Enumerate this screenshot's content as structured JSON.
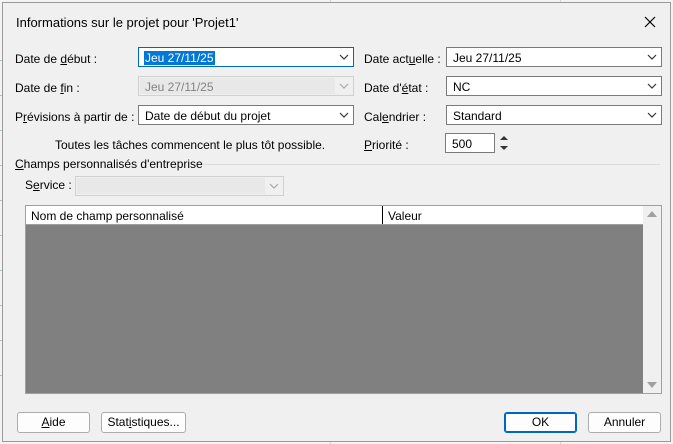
{
  "dialog": {
    "title": "Informations sur le projet pour 'Projet1'"
  },
  "fields": {
    "start_date": {
      "label_pre": "Date de ",
      "label_ul": "d",
      "label_post": "ébut :",
      "value": "Jeu 27/11/25"
    },
    "end_date": {
      "label_pre": "Date de ",
      "label_ul": "f",
      "label_post": "in :",
      "value": "Jeu 27/11/25"
    },
    "schedule_from": {
      "label_pre": "P",
      "label_ul": "r",
      "label_post": "évisions à partir de :",
      "value": "Date de début du projet"
    },
    "schedule_note": "Toutes les tâches commencent le plus tôt possible.",
    "current_date": {
      "label_pre": "Date act",
      "label_ul": "u",
      "label_post": "elle :",
      "value": "Jeu 27/11/25"
    },
    "status_date": {
      "label_pre": "Date d'",
      "label_ul": "é",
      "label_post": "tat :",
      "value": "NC"
    },
    "calendar": {
      "label_pre": "Cal",
      "label_ul": "e",
      "label_post": "ndrier :",
      "value": "Standard"
    },
    "priority": {
      "label_pre": "",
      "label_ul": "P",
      "label_post": "riorité :",
      "value": "500"
    }
  },
  "custom_fields": {
    "section_pre": "",
    "section_ul": "C",
    "section_post": "hamps personnalisés d'entreprise",
    "service_pre": "S",
    "service_ul": "e",
    "service_post": "rvice :",
    "service_value": "",
    "columns": [
      "Nom de champ personnalisé",
      "Valeur"
    ]
  },
  "buttons": {
    "help_pre": "",
    "help_ul": "A",
    "help_post": "ide",
    "stats_pre": "Stat",
    "stats_ul": "i",
    "stats_post": "stiques...",
    "ok": "OK",
    "cancel": "Annuler"
  },
  "colors": {
    "focus": "#0067c0",
    "selection": "#0078d7",
    "grid_body": "#808080"
  }
}
